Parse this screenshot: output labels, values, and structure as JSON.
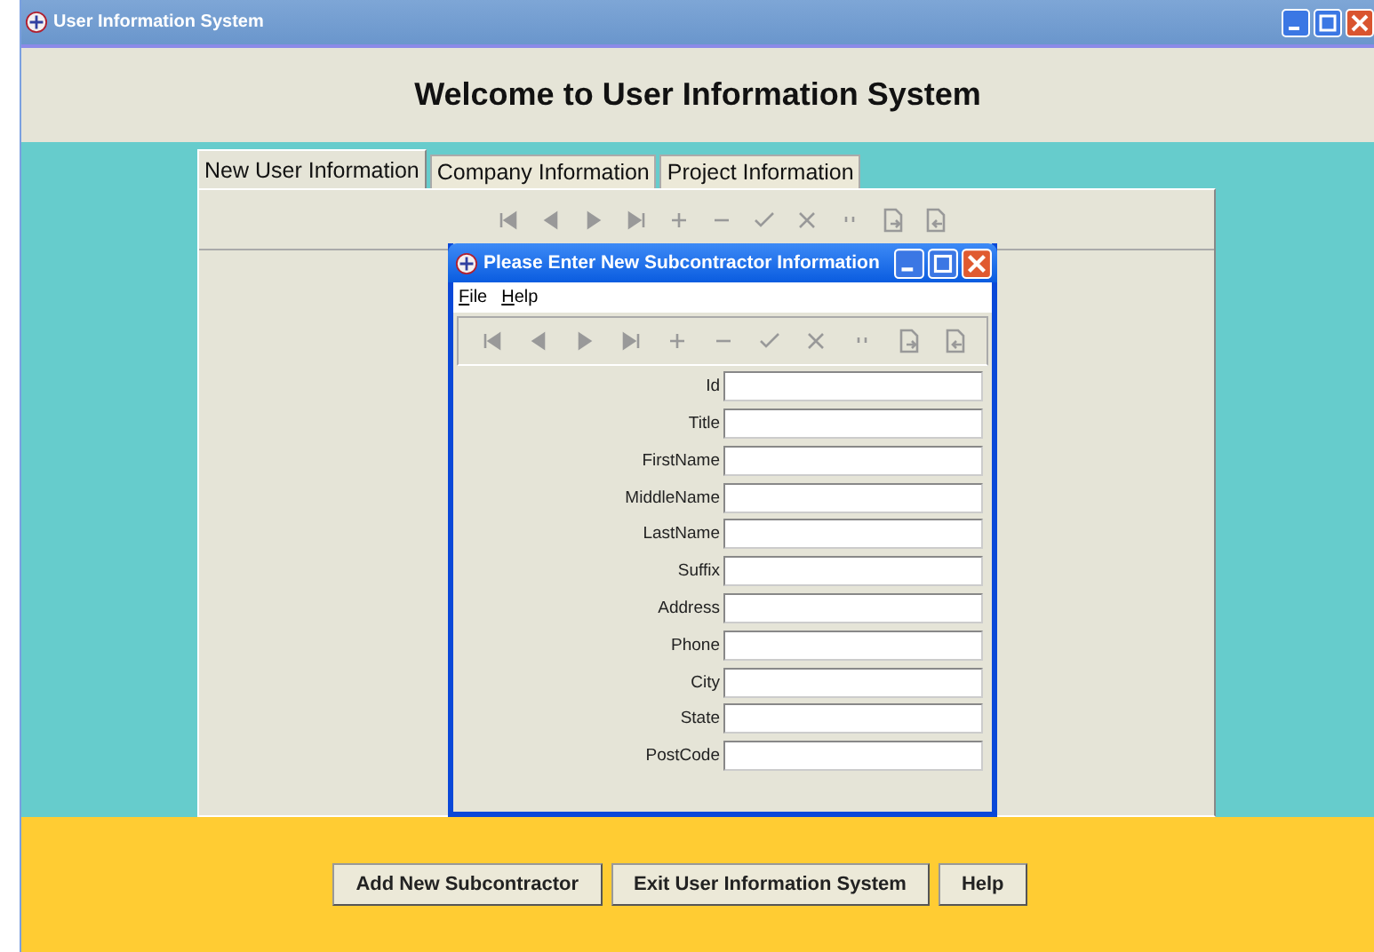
{
  "window": {
    "title": "User Information System"
  },
  "heading": "Welcome to User Information System",
  "tabs": [
    {
      "label": "New User Information",
      "selected": true
    },
    {
      "label": "Company Information",
      "selected": false
    },
    {
      "label": "Project Information",
      "selected": false
    }
  ],
  "dialog": {
    "title": "Please Enter New Subcontractor Information",
    "menu": [
      "File",
      "Help"
    ],
    "fields": [
      {
        "label": "Id"
      },
      {
        "label": "Title"
      },
      {
        "label": "FirstName"
      },
      {
        "label": "MiddleName"
      },
      {
        "label": "LastName"
      },
      {
        "label": "Suffix"
      },
      {
        "label": "Address"
      },
      {
        "label": "Phone"
      },
      {
        "label": "City"
      },
      {
        "label": "State"
      },
      {
        "label": "PostCode"
      }
    ]
  },
  "buttons": [
    "Add New Subcontractor",
    "Exit User Information System",
    "Help"
  ]
}
